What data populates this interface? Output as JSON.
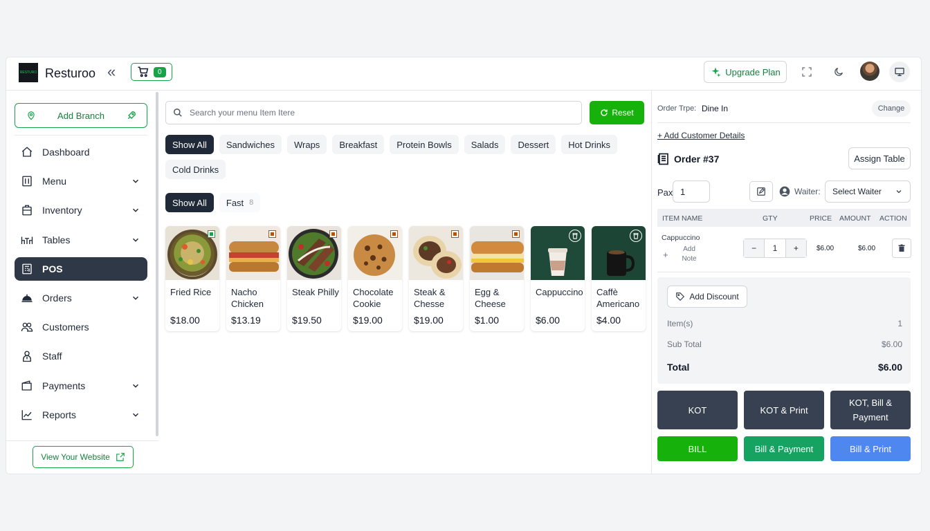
{
  "header": {
    "logo_text": "RESTURO",
    "brand": "Resturoo",
    "cart_count": "0",
    "upgrade_label": "Upgrade Plan"
  },
  "sidebar": {
    "add_branch": "Add Branch",
    "items": [
      {
        "label": "Dashboard",
        "icon": "home-icon",
        "expandable": false
      },
      {
        "label": "Menu",
        "icon": "menu-book-icon",
        "expandable": true
      },
      {
        "label": "Inventory",
        "icon": "inventory-icon",
        "expandable": true
      },
      {
        "label": "Tables",
        "icon": "tables-icon",
        "expandable": true
      },
      {
        "label": "POS",
        "icon": "pos-icon",
        "expandable": false,
        "active": true
      },
      {
        "label": "Orders",
        "icon": "cloche-icon",
        "expandable": true
      },
      {
        "label": "Customers",
        "icon": "customers-icon",
        "expandable": false
      },
      {
        "label": "Staff",
        "icon": "staff-icon",
        "expandable": false
      },
      {
        "label": "Payments",
        "icon": "wallet-icon",
        "expandable": true
      },
      {
        "label": "Reports",
        "icon": "chart-icon",
        "expandable": true
      }
    ],
    "view_website": "View Your Website"
  },
  "main": {
    "search_placeholder": "Search your menu Item Itere",
    "reset_label": "Reset",
    "categories": [
      "Show All",
      "Sandwiches",
      "Wraps",
      "Breakfast",
      "Protein Bowls",
      "Salads",
      "Dessert",
      "Hot Drinks",
      "Cold Drinks"
    ],
    "filters": [
      {
        "label": "Show All",
        "count": ""
      },
      {
        "label": "Fast",
        "count": "8"
      }
    ],
    "items": [
      {
        "name": "Fried Rice",
        "price": "$18.00",
        "badge": "veg"
      },
      {
        "name": "Nacho Chicken",
        "price": "$13.19",
        "badge": "nonveg"
      },
      {
        "name": "Steak Philly",
        "price": "$19.50",
        "badge": "nonveg"
      },
      {
        "name": "Chocolate Cookie",
        "price": "$19.00",
        "badge": "nonveg"
      },
      {
        "name": "Steak & Chesse",
        "price": "$19.00",
        "badge": "nonveg"
      },
      {
        "name": "Egg & Cheese",
        "price": "$1.00",
        "badge": "nonveg"
      },
      {
        "name": "Cappuccino",
        "price": "$6.00",
        "badge": "cup"
      },
      {
        "name": "Caffè Americano",
        "price": "$4.00",
        "badge": "cup"
      }
    ]
  },
  "order": {
    "type_label": "Order Trpe:",
    "type_value": "Dine In",
    "change_label": "Change",
    "add_customer": "+ Add Customer Details",
    "order_no": "Order #37",
    "assign_table": "Assign Table",
    "pax_label": "Pax",
    "pax_value": "1",
    "waiter_label": "Waiter:",
    "waiter_select": "Select Waiter",
    "columns": [
      "ITEM NAME",
      "GTY",
      "PRICE",
      "AMOUNT",
      "ACTION"
    ],
    "line": {
      "name": "Cappuccino",
      "note": "Add Note",
      "qty": "1",
      "price": "$6.00",
      "amount": "$6.00"
    },
    "add_discount": "Add Discount",
    "items_label": "Item(s)",
    "items_value": "1",
    "subtotal_label": "Sub Total",
    "subtotal_value": "$6.00",
    "total_label": "Total",
    "total_value": "$6.00",
    "actions": {
      "kot": "KOT",
      "kot_print": "KOT & Print",
      "kot_bill_payment": "KOT, Bill & Payment",
      "bill": "BILL",
      "bill_payment": "Bill & Payment",
      "bill_print": "Bill & Print"
    }
  },
  "colors": {
    "accent": "#16b10a",
    "dark": "#374151",
    "teal": "#16a260",
    "blue": "#4f87f0"
  }
}
